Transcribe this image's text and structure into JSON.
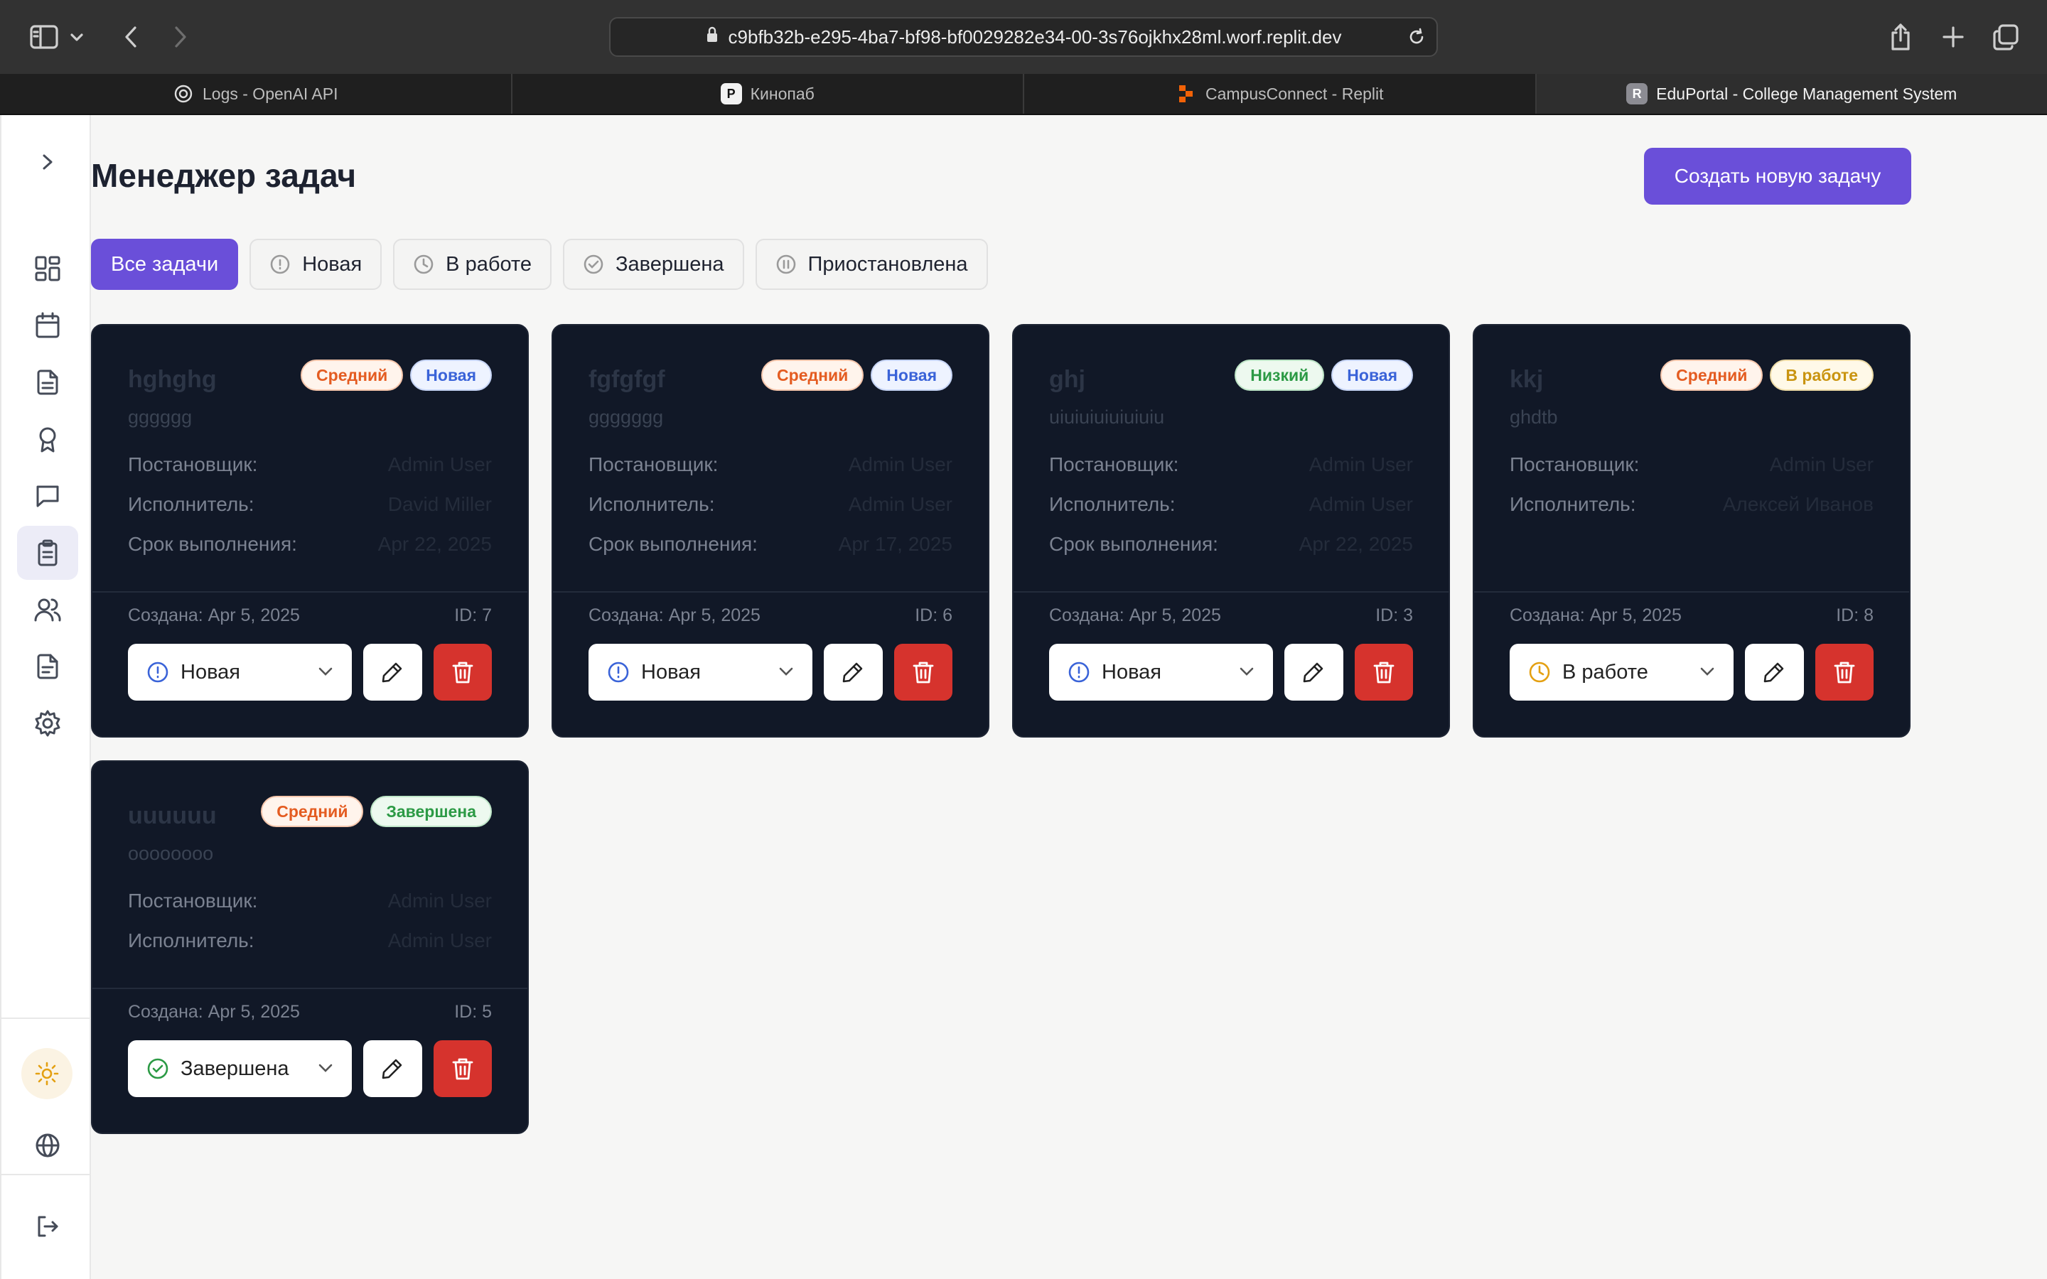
{
  "browser": {
    "url": "c9bfb32b-e295-4ba7-bf98-bf0029282e34-00-3s76ojkhx28ml.worf.replit.dev",
    "tabs": [
      {
        "title": "Logs - OpenAI API",
        "icon": "openai-icon"
      },
      {
        "title": "Кинопаб",
        "icon": "kinopub-icon"
      },
      {
        "title": "CampusConnect - Replit",
        "icon": "replit-icon"
      },
      {
        "title": "EduPortal - College Management System",
        "icon": "R"
      }
    ]
  },
  "page": {
    "title": "Менеджер задач",
    "create_button": "Создать новую задачу"
  },
  "filters": [
    "Все задачи",
    "Новая",
    "В работе",
    "Завершена",
    "Приостановлена"
  ],
  "labels": {
    "assigner": "Постановщик:",
    "assignee": "Исполнитель:",
    "due": "Срок выполнения:"
  },
  "cards": [
    {
      "title": "hghghg",
      "priority": "Средний",
      "status_badge": "Новая",
      "description": "gggggg",
      "assigner": "Admin User",
      "assignee": "David Miller",
      "due": "Apr 22, 2025",
      "created": "Создана: Apr 5, 2025",
      "id": "ID: 7",
      "status_select": "Новая"
    },
    {
      "title": "fgfgfgf",
      "priority": "Средний",
      "status_badge": "Новая",
      "description": "ggggggg",
      "assigner": "Admin User",
      "assignee": "Admin User",
      "due": "Apr 17, 2025",
      "created": "Создана: Apr 5, 2025",
      "id": "ID: 6",
      "status_select": "Новая"
    },
    {
      "title": "ghj",
      "priority": "Низкий",
      "status_badge": "Новая",
      "description": "uiuiuiuiuiuiuiu",
      "assigner": "Admin User",
      "assignee": "Admin User",
      "due": "Apr 22, 2025",
      "created": "Создана: Apr 5, 2025",
      "id": "ID: 3",
      "status_select": "Новая"
    },
    {
      "title": "kkj",
      "priority": "Средний",
      "status_badge": "В работе",
      "description": "ghdtb",
      "assigner": "Admin User",
      "assignee": "Алексей Иванов",
      "created": "Создана: Apr 5, 2025",
      "id": "ID: 8",
      "status_select": "В работе"
    },
    {
      "title": "uuuuuu",
      "priority": "Средний",
      "status_badge": "Завершена",
      "description": "oooooooo",
      "assigner": "Admin User",
      "assignee": "Admin User",
      "created": "Создана: Apr 5, 2025",
      "id": "ID: 5",
      "status_select": "Завершена"
    }
  ],
  "colors": {
    "accent": "#6a4fd9",
    "card_bg": "#111827",
    "danger": "#d6332d"
  }
}
